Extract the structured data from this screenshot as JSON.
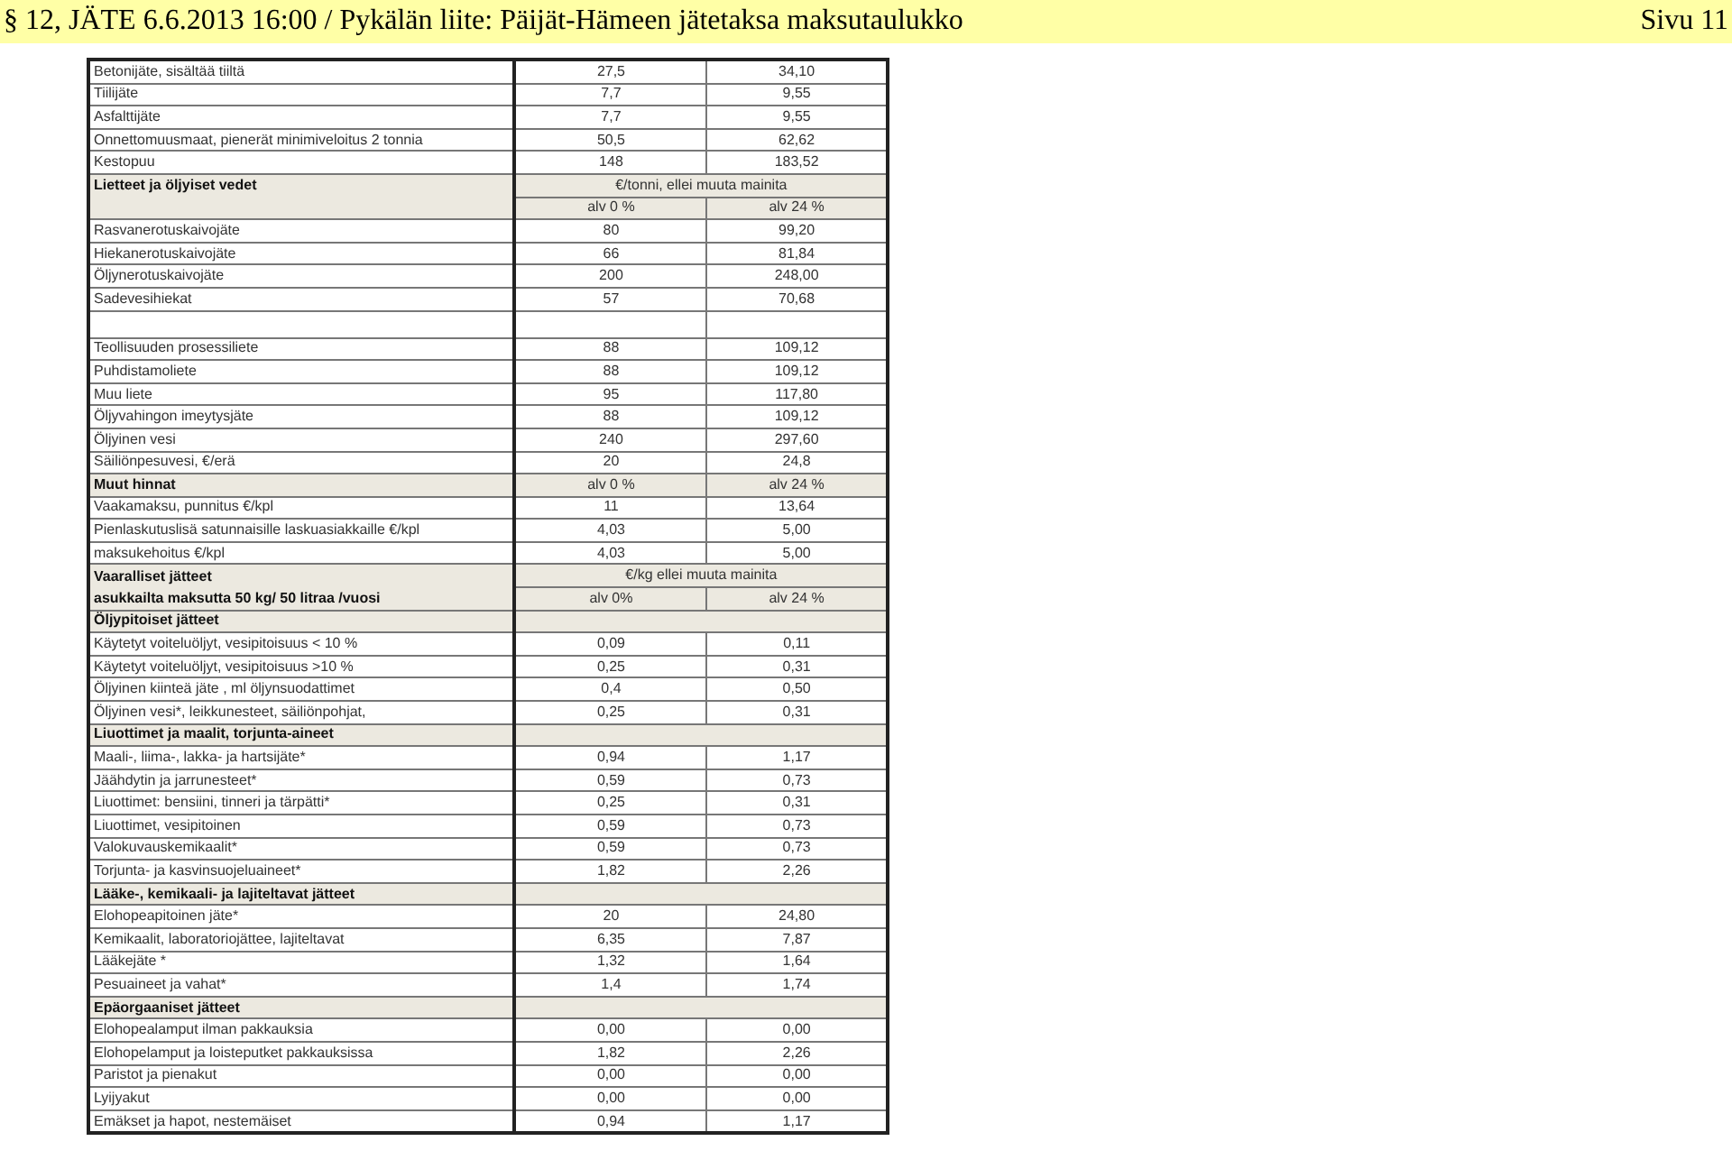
{
  "header": {
    "title": "§ 12, JÄTE 6.6.2013 16:00 / Pykälän liite: Päijät-Hämeen jätetaksa maksutaulukko",
    "page": "Sivu 11"
  },
  "rows": [
    {
      "kind": "item",
      "label": "Betonijäte, sisältää tiiltä",
      "values": [
        "27,5",
        "34,10"
      ]
    },
    {
      "kind": "item",
      "label": "Tiilijäte",
      "values": [
        "7,7",
        "9,55"
      ]
    },
    {
      "kind": "item",
      "label": "Asfalttijäte",
      "values": [
        "7,7",
        "9,55"
      ]
    },
    {
      "kind": "item",
      "label": "Onnettomuusmaat, pienerät minimiveloitus 2 tonnia",
      "values": [
        "50,5",
        "62,62"
      ]
    },
    {
      "kind": "item",
      "label": "Kestopuu",
      "values": [
        "148",
        "183,52"
      ]
    },
    {
      "kind": "section",
      "label": "Lietteet ja öljyiset vedet",
      "caption": "€/tonni, ellei muuta mainita",
      "columns": [
        "alv 0 %",
        "alv 24 %"
      ]
    },
    {
      "kind": "item",
      "label": "Rasvanerotuskaivojäte",
      "values": [
        "80",
        "99,20"
      ]
    },
    {
      "kind": "item",
      "label": "Hiekanerotuskaivojäte",
      "values": [
        "66",
        "81,84"
      ]
    },
    {
      "kind": "item",
      "label": "Öljynerotuskaivojäte",
      "values": [
        "200",
        "248,00"
      ]
    },
    {
      "kind": "item",
      "label": "Sadevesihiekat",
      "values": [
        "57",
        "70,68"
      ]
    },
    {
      "kind": "blank"
    },
    {
      "kind": "item",
      "label": "Teollisuuden prosessiliete",
      "values": [
        "88",
        "109,12"
      ]
    },
    {
      "kind": "item",
      "label": "Puhdistamoliete",
      "values": [
        "88",
        "109,12"
      ]
    },
    {
      "kind": "item",
      "label": "Muu liete",
      "values": [
        "95",
        "117,80"
      ]
    },
    {
      "kind": "item",
      "label": "Öljyvahingon imeytysjäte",
      "values": [
        "88",
        "109,12"
      ]
    },
    {
      "kind": "item",
      "label": "Öljyinen vesi",
      "values": [
        "240",
        "297,60"
      ]
    },
    {
      "kind": "item",
      "label": "Säiliönpesuvesi, €/erä",
      "values": [
        "20",
        "24,8"
      ]
    },
    {
      "kind": "heading",
      "label": "Muut hinnat",
      "columns": [
        "alv 0 %",
        "alv 24 %"
      ]
    },
    {
      "kind": "item",
      "label": "Vaakamaksu, punnitus €/kpl",
      "values": [
        "11",
        "13,64"
      ]
    },
    {
      "kind": "item",
      "label": "Pienlaskutuslisä satunnaisille laskuasiakkaille €/kpl",
      "values": [
        "4,03",
        "5,00"
      ]
    },
    {
      "kind": "item",
      "label": "maksukehoitus €/kpl",
      "values": [
        "4,03",
        "5,00"
      ]
    },
    {
      "kind": "section",
      "label": "Vaaralliset jätteet",
      "label_2": "asukkailta maksutta 50 kg/ 50 litraa /vuosi",
      "caption": "€/kg ellei muuta mainita",
      "columns": [
        "alv 0%",
        "alv 24 %"
      ]
    },
    {
      "kind": "group",
      "label": "Öljypitoiset jätteet"
    },
    {
      "kind": "item",
      "label": "Käytetyt voiteluöljyt, vesipitoisuus < 10 %",
      "values": [
        "0,09",
        "0,11"
      ]
    },
    {
      "kind": "item",
      "label": "Käytetyt voiteluöljyt, vesipitoisuus >10 %",
      "values": [
        "0,25",
        "0,31"
      ]
    },
    {
      "kind": "item",
      "label": "Öljyinen kiinteä jäte , ml öljynsuodattimet",
      "values": [
        "0,4",
        "0,50"
      ]
    },
    {
      "kind": "item",
      "label": "Öljyinen vesi*, leikkunesteet, säiliönpohjat,",
      "values": [
        "0,25",
        "0,31"
      ]
    },
    {
      "kind": "group",
      "label": "Liuottimet ja maalit, torjunta-aineet"
    },
    {
      "kind": "item",
      "label": "Maali-, liima-, lakka- ja hartsijäte*",
      "values": [
        "0,94",
        "1,17"
      ]
    },
    {
      "kind": "item",
      "label": "Jäähdytin ja jarrunesteet*",
      "values": [
        "0,59",
        "0,73"
      ]
    },
    {
      "kind": "item",
      "label": "Liuottimet: bensiini, tinneri ja tärpätti*",
      "values": [
        "0,25",
        "0,31"
      ]
    },
    {
      "kind": "item",
      "label": "Liuottimet, vesipitoinen",
      "values": [
        "0,59",
        "0,73"
      ]
    },
    {
      "kind": "item",
      "label": "Valokuvauskemikaalit*",
      "values": [
        "0,59",
        "0,73"
      ]
    },
    {
      "kind": "item",
      "label": "Torjunta- ja kasvinsuojeluaineet*",
      "values": [
        "1,82",
        "2,26"
      ]
    },
    {
      "kind": "group",
      "label": "Lääke-, kemikaali- ja lajiteltavat jätteet"
    },
    {
      "kind": "item",
      "label": "Elohopeapitoinen jäte*",
      "values": [
        "20",
        "24,80"
      ]
    },
    {
      "kind": "item",
      "label": "Kemikaalit, laboratoriojättee, lajiteltavat",
      "values": [
        "6,35",
        "7,87"
      ]
    },
    {
      "kind": "item",
      "label": "Lääkejäte *",
      "values": [
        "1,32",
        "1,64"
      ]
    },
    {
      "kind": "item",
      "label": "Pesuaineet ja vahat*",
      "values": [
        "1,4",
        "1,74"
      ]
    },
    {
      "kind": "group",
      "label": "Epäorgaaniset jätteet"
    },
    {
      "kind": "item",
      "label": "Elohopealamput ilman pakkauksia",
      "values": [
        "0,00",
        "0,00"
      ]
    },
    {
      "kind": "item",
      "label": "Elohopelamput ja loisteputket pakkauksissa",
      "values": [
        "1,82",
        "2,26"
      ]
    },
    {
      "kind": "item",
      "label": "Paristot ja pienakut",
      "values": [
        "0,00",
        "0,00"
      ]
    },
    {
      "kind": "item",
      "label": "Lyijyakut",
      "values": [
        "0,00",
        "0,00"
      ]
    },
    {
      "kind": "item",
      "label": "Emäkset ja hapot, nestemäiset",
      "values": [
        "0,94",
        "1,17"
      ]
    }
  ]
}
